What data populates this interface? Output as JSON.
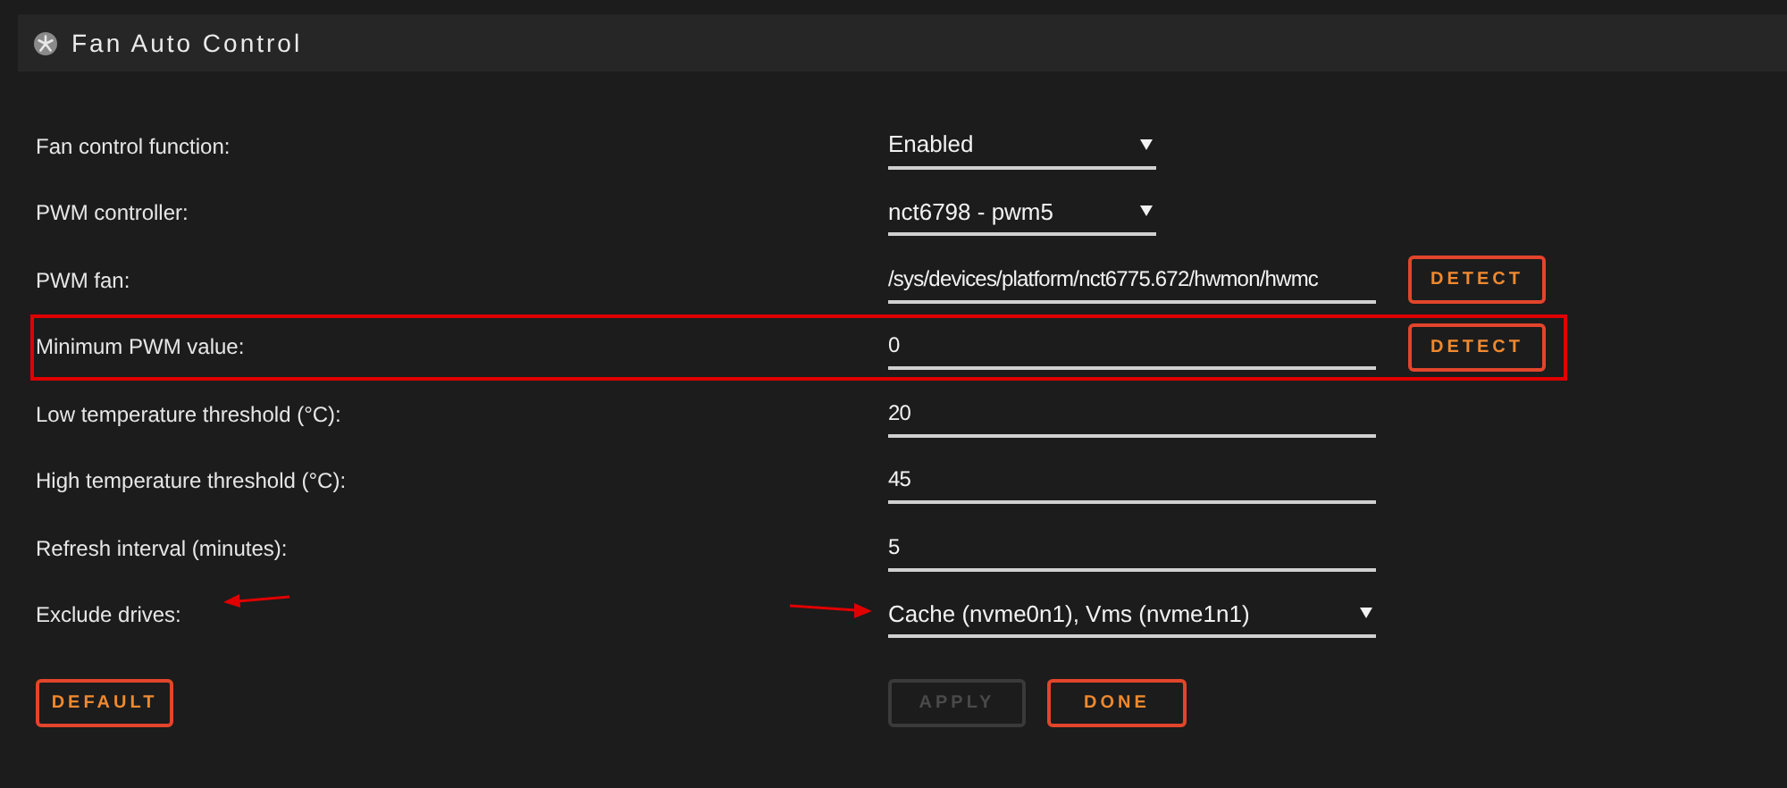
{
  "header": {
    "title": "Fan Auto Control"
  },
  "settings": [
    {
      "label": "Fan control function:",
      "kind": "select",
      "value": "Enabled",
      "highlighted": false,
      "arrows": false
    },
    {
      "label": "PWM controller:",
      "kind": "select",
      "value": "nct6798 - pwm5",
      "highlighted": false,
      "arrows": false
    },
    {
      "label": "PWM fan:",
      "kind": "text",
      "value": "/sys/devices/platform/nct6775.672/hwmon/hwmc",
      "button": "DETECT",
      "highlighted": false,
      "arrows": false
    },
    {
      "label": "Minimum PWM value:",
      "kind": "text",
      "value": "0",
      "button": "DETECT",
      "highlighted": true,
      "arrows": false
    },
    {
      "label": "Low temperature threshold (°C):",
      "kind": "text",
      "value": "20",
      "highlighted": false,
      "arrows": false
    },
    {
      "label": "High temperature threshold (°C):",
      "kind": "text",
      "value": "45",
      "highlighted": false,
      "arrows": false
    },
    {
      "label": "Refresh interval (minutes):",
      "kind": "text",
      "value": "5",
      "highlighted": false,
      "arrows": false
    },
    {
      "label": "Exclude drives:",
      "kind": "wide-select",
      "value": "Cache (nvme0n1), Vms (nvme1n1)",
      "highlighted": false,
      "arrows": true
    }
  ],
  "actions": {
    "default": {
      "label": "DEFAULT",
      "disabled": false
    },
    "apply": {
      "label": "APPLY",
      "disabled": true
    },
    "done": {
      "label": "DONE",
      "disabled": false
    }
  }
}
